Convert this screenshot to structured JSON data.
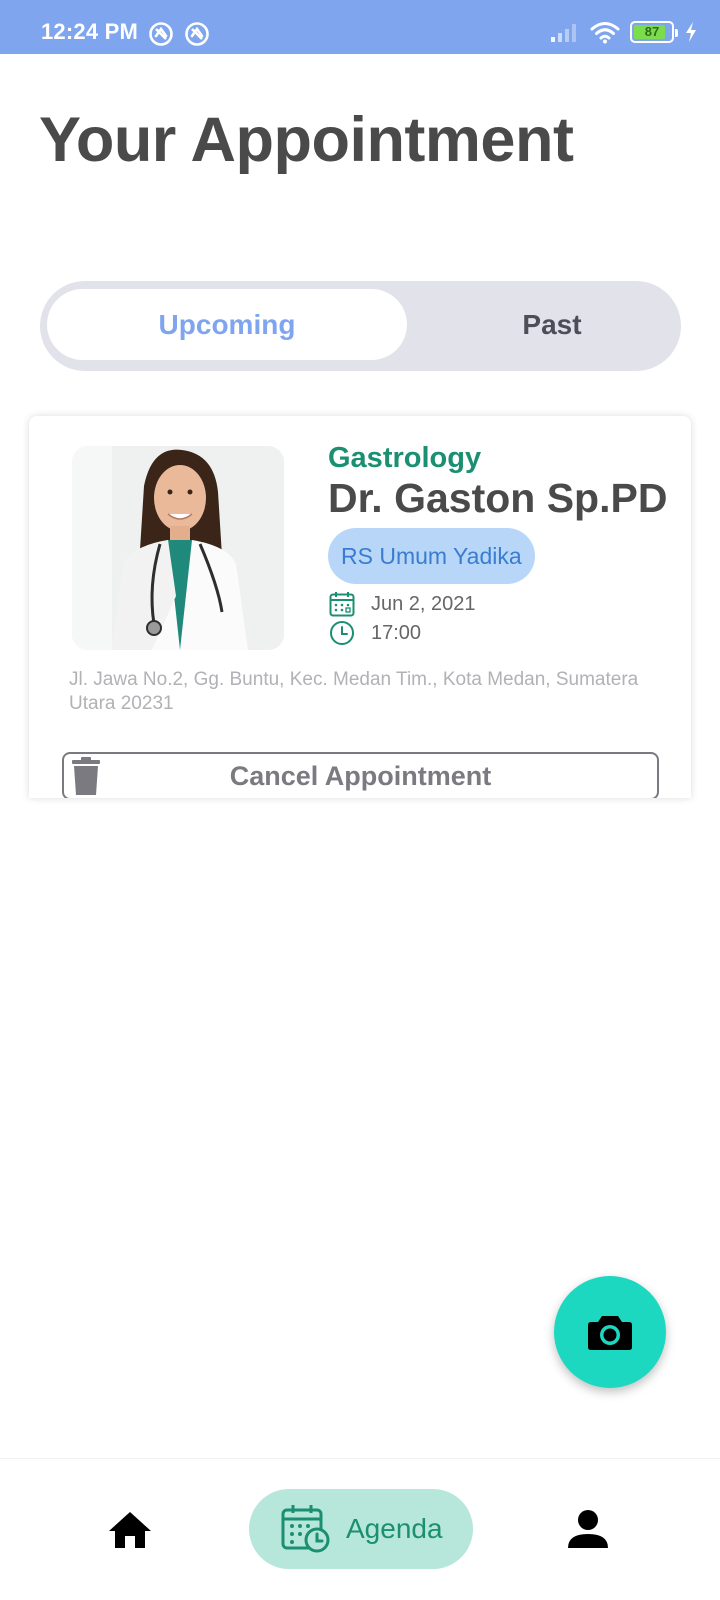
{
  "status_bar": {
    "time": "12:24 PM",
    "battery": "87",
    "battery_level": 0.87
  },
  "header": {
    "title": "Your Appointment"
  },
  "tabs": [
    {
      "label": "Upcoming",
      "selected": true
    },
    {
      "label": "Past",
      "selected": false
    }
  ],
  "appointment": {
    "specialty": "Gastrology",
    "doctor": "Dr. Gaston Sp.PD",
    "hospital": "RS Umum Yadika",
    "date": "Jun 2, 2021",
    "time": "17:00",
    "address": "Jl. Jawa No.2, Gg. Buntu, Kec. Medan Tim., Kota Medan, Sumatera Utara 20231",
    "cancel_label": "Cancel Appointment"
  },
  "bottom_nav": {
    "items": [
      {
        "icon": "home-icon",
        "label": ""
      },
      {
        "icon": "calendar-clock-icon",
        "label": "Agenda",
        "active": true
      },
      {
        "icon": "person-icon",
        "label": ""
      }
    ]
  },
  "colors": {
    "accent_blue": "#7fa5ef",
    "accent_green": "#1b8f71",
    "fab": "#1dd8c0",
    "chip_bg": "#b8d6f8",
    "nav_active_bg": "#b7e6da"
  }
}
